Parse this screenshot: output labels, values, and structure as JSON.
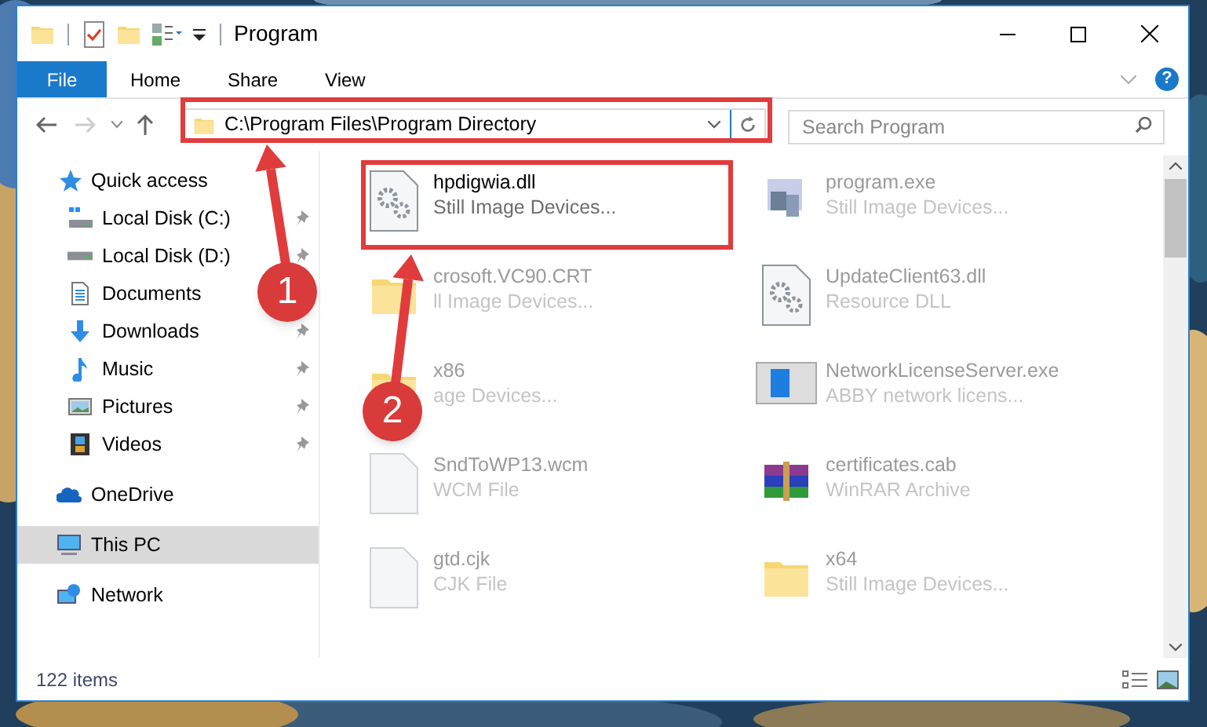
{
  "window": {
    "title": "Program"
  },
  "ribbon": {
    "tabs": [
      {
        "label": "File",
        "kind": "file",
        "selected": false
      },
      {
        "label": "Home",
        "kind": "tab",
        "selected": false
      },
      {
        "label": "Share",
        "kind": "tab",
        "selected": false
      },
      {
        "label": "View",
        "kind": "tab",
        "selected": false
      }
    ],
    "help_label": "?"
  },
  "address_bar": {
    "path": "C:\\Program Files\\Program Directory"
  },
  "search": {
    "placeholder": "Search Program"
  },
  "navigation": [
    {
      "label": "Quick access",
      "kind": "star",
      "selected": false,
      "children": [
        {
          "label": "Local Disk (C:)",
          "kind": "system",
          "pinned": true,
          "selected": false
        },
        {
          "label": "Local Disk (D:)",
          "kind": "drive",
          "pinned": true,
          "selected": false
        },
        {
          "label": "Documents",
          "kind": "document",
          "selected": false
        },
        {
          "label": "Downloads",
          "kind": "download",
          "pinned": true,
          "selected": false
        },
        {
          "label": "Music",
          "kind": "music",
          "pinned": true,
          "selected": false
        },
        {
          "label": "Pictures",
          "kind": "pictures",
          "pinned": true,
          "selected": false
        },
        {
          "label": "Videos",
          "kind": "videos",
          "pinned": true,
          "selected": false
        }
      ]
    },
    {
      "label": "OneDrive",
      "kind": "cloud",
      "selected": false
    },
    {
      "label": "This PC",
      "kind": "computer",
      "selected": true
    },
    {
      "label": "Network",
      "kind": "network",
      "selected": false
    }
  ],
  "files": [
    {
      "name": "hpdigwia.dll",
      "type": "Still Image Devices...",
      "kind": "library",
      "blurred": false
    },
    {
      "name": "program.exe",
      "type": "Still Image Devices...",
      "kind": "app",
      "blurred": true
    },
    {
      "name": "crosoft.VC90.CRT",
      "type": "ll Image Devices...",
      "kind": "folder",
      "blurred": true
    },
    {
      "name": "UpdateClient63.dll",
      "type": "Resource DLL",
      "kind": "library",
      "blurred": true
    },
    {
      "name": "x86",
      "type": "age Devices...",
      "kind": "folder",
      "blurred": true
    },
    {
      "name": "NetworkLicenseServer.exe",
      "type": "ABBY network licens...",
      "kind": "window",
      "blurred": true
    },
    {
      "name": "SndToWP13.wcm",
      "type": "WCM File",
      "kind": "file",
      "blurred": true
    },
    {
      "name": "certificates.cab",
      "type": "WinRAR Archive",
      "kind": "archive",
      "blurred": true
    },
    {
      "name": "gtd.cjk",
      "type": "CJK File",
      "kind": "file",
      "blurred": true
    },
    {
      "name": "x64",
      "type": "Still Image Devices...",
      "kind": "folder",
      "blurred": true
    }
  ],
  "status_bar": {
    "item_count": "122 items"
  },
  "annotations": [
    {
      "kind": "box"
    },
    {
      "kind": "box"
    },
    {
      "kind": "arrow",
      "number": "1"
    },
    {
      "kind": "arrow",
      "number": "2"
    }
  ]
}
